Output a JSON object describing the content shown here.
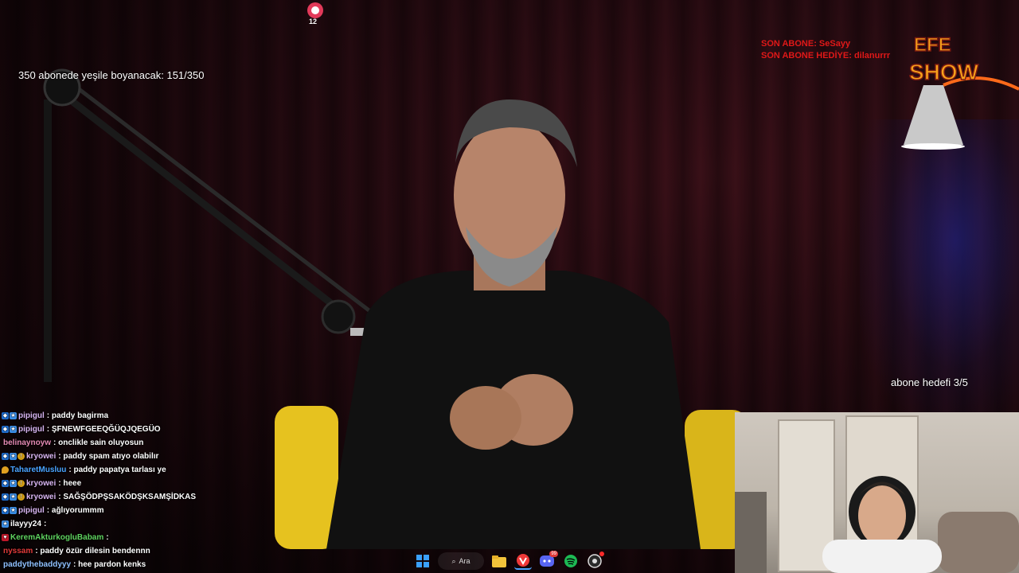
{
  "overlay": {
    "goal_text": "350 abonede yeşile boyanacak: 151/350",
    "sub_goal_text": "abone hedefi 3/5",
    "last_sub_label": "SON ABONE: SeSayy",
    "last_gift_label": "SON ABONE HEDİYE: dilanurrr",
    "logo_line1": "EFE",
    "logo_line2": "SHOW",
    "top_badge_count": "12"
  },
  "chat": [
    {
      "badges": [
        "prime",
        "sub"
      ],
      "user": "pipigul",
      "user_color": "#d7b4f0",
      "message": ": paddy bagirma"
    },
    {
      "badges": [
        "prime",
        "sub"
      ],
      "user": "pipigul",
      "user_color": "#d7b4f0",
      "message": ": ŞFNEWFGEEQĞÜQJQEGÜO"
    },
    {
      "badges": [],
      "user": "belinaynoyw",
      "user_color": "#e58ab4",
      "message": ": onclikle sain oluyosun"
    },
    {
      "badges": [
        "prime",
        "sub",
        "gift"
      ],
      "user": "kryowei",
      "user_color": "#d7b4f0",
      "message": ": paddy spam atıyo olabilır"
    },
    {
      "badges": [
        "drop"
      ],
      "user": "TaharetMusluu",
      "user_color": "#4aa3ff",
      "message": ": paddy papatya tarlası ye"
    },
    {
      "badges": [
        "prime",
        "sub",
        "gift"
      ],
      "user": "kryowei",
      "user_color": "#d7b4f0",
      "message": ": heee"
    },
    {
      "badges": [
        "prime",
        "sub",
        "gift"
      ],
      "user": "kryowei",
      "user_color": "#d7b4f0",
      "message": ": SAĞŞÖDPŞSAKÖDŞKSAMŞİDKAS"
    },
    {
      "badges": [
        "prime",
        "sub"
      ],
      "user": "pipigul",
      "user_color": "#d7b4f0",
      "message": ": ağlıyorummm"
    },
    {
      "badges": [
        "sub"
      ],
      "user": "ilayyy24",
      "user_color": "#ffffff",
      "message": ":"
    },
    {
      "badges": [
        "heart"
      ],
      "user": "KeremAkturkogluBabam",
      "user_color": "#5fd35f",
      "message": ":"
    },
    {
      "badges": [],
      "user": "nyssam",
      "user_color": "#e23a3a",
      "message": ": paddy özür dilesin bendennn"
    },
    {
      "badges": [],
      "user": "paddythebaddyyy",
      "user_color": "#8fc0ff",
      "message": ": hee pardon kenks"
    }
  ],
  "taskbar": {
    "search_label": "Ara",
    "icons": [
      "windows-start-icon",
      "search-icon",
      "file-explorer-icon",
      "vivaldi-browser-icon",
      "discord-icon",
      "spotify-icon",
      "obs-icon"
    ],
    "discord_badge": "99"
  },
  "colors": {
    "last_sub_red": "#e01818",
    "logo_orange": "#f7a21b",
    "chair_yellow": "#e6c21f"
  }
}
